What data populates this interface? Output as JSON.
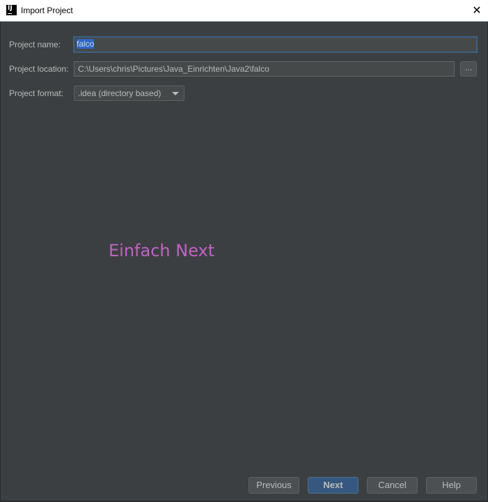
{
  "window": {
    "title": "Import Project",
    "app_icon_text": "IJ",
    "close_symbol": "✕"
  },
  "form": {
    "name_label": "Project name:",
    "name_value": "falco",
    "location_label": "Project location:",
    "location_value": "C:\\Users\\chris\\Pictures\\Java_Einrichten\\Java2\\falco",
    "browse_label": "...",
    "format_label": "Project format:",
    "format_value": ".idea (directory based)"
  },
  "annotation": {
    "text": "Einfach Next",
    "color": "#c063c4"
  },
  "footer": {
    "previous": "Previous",
    "next": "Next",
    "cancel": "Cancel",
    "help": "Help"
  },
  "colors": {
    "background": "#3c3f41",
    "field_bg": "#45494a",
    "focus_border": "#3d6185",
    "default_button": "#365880"
  }
}
